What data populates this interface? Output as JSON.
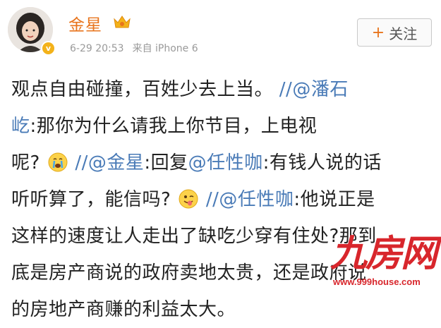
{
  "user": {
    "name": "金星",
    "vip_badge": "v",
    "timestamp": "6-29 20:53",
    "source": "来自 iPhone 6"
  },
  "follow": {
    "plus": "+",
    "label": "关注"
  },
  "post": {
    "line1": {
      "text": "观点自由碰撞，百姓少去上当。",
      "slash": "//",
      "mention": "@潘石"
    },
    "line2": {
      "mention": "屹",
      "text": ":那你为什么请我上你节目，上电视"
    },
    "line3": {
      "text_a": "呢?",
      "slash": "//",
      "mention1": "@金星",
      "text_b": ":回复",
      "mention2": "@任性咖",
      "text_c": ":有钱人说的话"
    },
    "line4": {
      "text_a": "听听算了，能信吗?",
      "slash": "//",
      "mention": "@任性咖",
      "text_b": ":他说正是"
    },
    "line5": {
      "text": "这样的速度让人走出了缺吃少穿有住处?那到"
    },
    "line6": {
      "text": "底是房产商说的政府卖地太贵，还是政府说"
    },
    "line7": {
      "text": "的房地产商赚的利益太大。"
    }
  },
  "watermark": {
    "logo": "九房网",
    "url": "www.999house.com"
  },
  "colors": {
    "name": "#e8741c",
    "mention": "#4a7bb7",
    "watermark": "#d8262c",
    "vip": "#f3b21a"
  },
  "icons": [
    "crown-icon",
    "crying-emoji-icon",
    "tongue-wink-emoji-icon",
    "verified-badge-icon"
  ]
}
